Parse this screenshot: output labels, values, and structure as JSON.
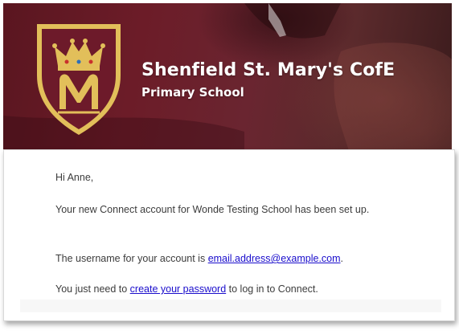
{
  "header": {
    "school_name": "Shenfield St. Mary's CofE",
    "school_subtitle": "Primary School",
    "crest": {
      "icon": "school-crest-icon",
      "letter": "M",
      "colors": {
        "maroon": "#6d1a2a",
        "gold": "#e2bf5a"
      }
    },
    "banner_color": "#6c1c28"
  },
  "email": {
    "greeting": "Hi Anne,",
    "body": "Your new Connect account for Wonde Testing School has been set up.",
    "username_prefix": "The username for your account is ",
    "username_link": "email.address@example.com",
    "username_suffix": ".",
    "password_prefix": "You just need to ",
    "password_link": "create your password",
    "password_suffix": " to log in to Connect.",
    "link_color": "#1a0dcc"
  }
}
